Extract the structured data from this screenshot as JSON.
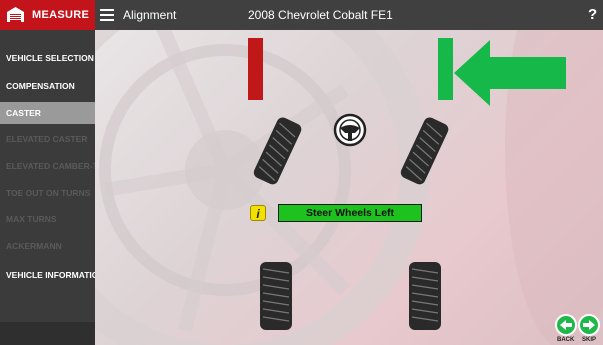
{
  "header": {
    "measure_label": "MEASURE",
    "screen_title": "Alignment",
    "vehicle_title": "2008 Chevrolet Cobalt FE1",
    "help_label": "?"
  },
  "sidebar": {
    "items": [
      {
        "label": "VEHICLE SELECTION",
        "state": "enabled"
      },
      {
        "label": "COMPENSATION",
        "state": "enabled"
      },
      {
        "label": "CASTER",
        "state": "active"
      },
      {
        "label": "ELEVATED CASTER",
        "state": "disabled"
      },
      {
        "label": "ELEVATED CAMBER-TOE",
        "state": "disabled"
      },
      {
        "label": "TOE OUT ON TURNS",
        "state": "disabled"
      },
      {
        "label": "MAX TURNS",
        "state": "disabled"
      },
      {
        "label": "ACKERMANN",
        "state": "disabled"
      },
      {
        "label": "VEHICLE INFORMATION",
        "state": "enabled"
      }
    ]
  },
  "main": {
    "instruction": "Steer Wheels Left",
    "info_icon": "i",
    "indicator_left_color": "#c01818",
    "indicator_right_color": "#16b84a",
    "arrow_direction": "left"
  },
  "nav": {
    "back_label": "BACK",
    "skip_label": "SKIP"
  },
  "colors": {
    "brand_red": "#c4141b",
    "accent_green": "#1ec21e"
  }
}
